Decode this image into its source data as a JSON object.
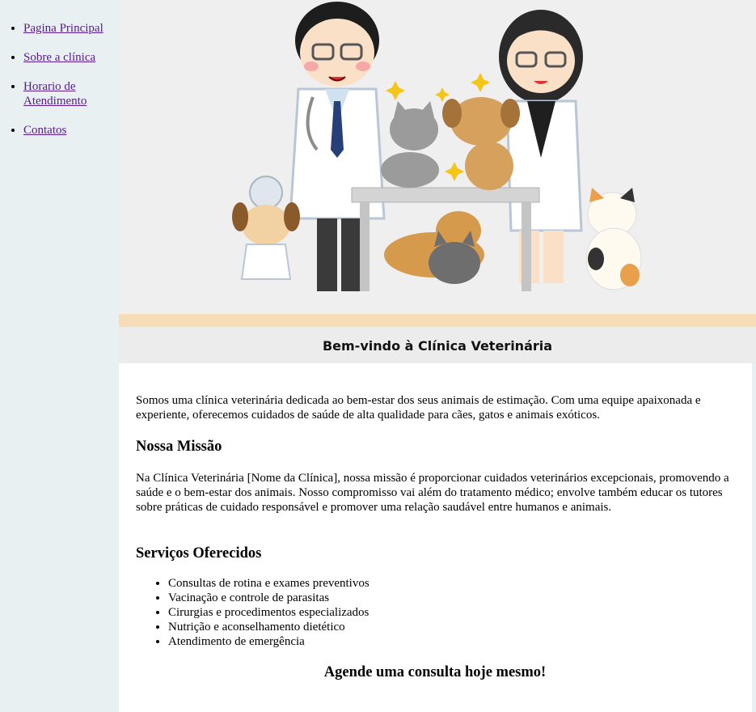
{
  "nav": {
    "items": [
      {
        "label": "Pagina Principal"
      },
      {
        "label": "Sobre a clínica"
      },
      {
        "label": "Horario de Atendimento"
      },
      {
        "label": "Contatos"
      }
    ]
  },
  "hero": {
    "caption": "Bem-vindo à Clínica Veterinária"
  },
  "content": {
    "intro": "Somos uma clínica veterinária dedicada ao bem-estar dos seus animais de estimação. Com uma equipe apaixonada e experiente, oferecemos cuidados de saúde de alta qualidade para cães, gatos e animais exóticos.",
    "mission_title": "Nossa Missão",
    "mission_text": "Na Clínica Veterinária [Nome da Clínica], nossa missão é proporcionar cuidados veterinários excepcionais, promovendo a saúde e o bem-estar dos animais. Nosso compromisso vai além do tratamento médico; envolve também educar os tutores sobre práticas de cuidado responsável e promover uma relação saudável entre humanos e animais.",
    "services_title": "Serviços Oferecidos",
    "services": [
      "Consultas de rotina e exames preventivos",
      "Vacinação e controle de parasitas",
      "Cirurgias e procedimentos especializados",
      "Nutrição e aconselhamento dietético",
      "Atendimento de emergência"
    ],
    "cta": "Agende uma consulta hoje mesmo!"
  }
}
